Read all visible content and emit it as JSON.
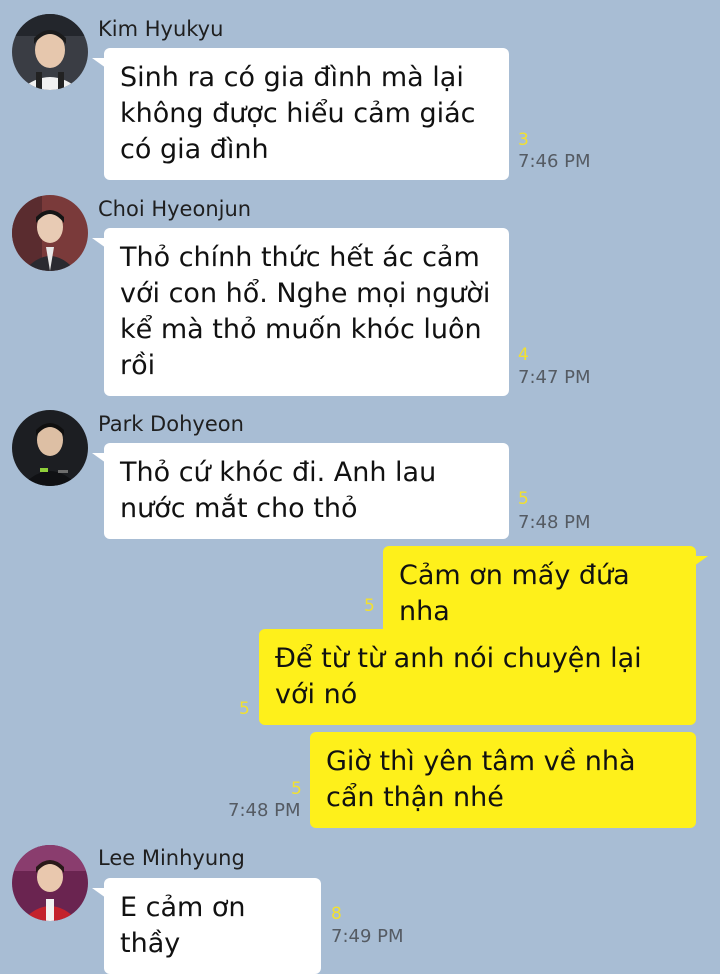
{
  "colors": {
    "background": "#a8bdd4",
    "incoming_bubble": "#ffffff",
    "outgoing_bubble": "#fef01b",
    "unread": "#f2e030"
  },
  "messages": [
    {
      "sender": "Kim Hyukyu",
      "avatar_icon": "profile-photo-icon",
      "text": "Sinh ra có gia đình mà lại không được hiểu cảm giác có gia đình",
      "unread": "3",
      "time": "7:46 PM"
    },
    {
      "sender": "Choi Hyeonjun",
      "avatar_icon": "profile-photo-icon",
      "text": "Thỏ chính thức hết ác cảm với con hổ. Nghe mọi người kể mà thỏ muốn khóc luôn rồi",
      "unread": "4",
      "time": "7:47 PM"
    },
    {
      "sender": "Park Dohyeon",
      "avatar_icon": "profile-photo-icon",
      "text": "Thỏ cứ khóc đi. Anh lau nước mắt cho thỏ",
      "unread": "5",
      "time": "7:48 PM"
    },
    {
      "sender": "",
      "text": "Cảm ơn mấy đứa nha",
      "unread": "5",
      "time": ""
    },
    {
      "sender": "",
      "text": "Để từ từ anh nói chuyện lại với nó",
      "unread": "5",
      "time": ""
    },
    {
      "sender": "",
      "text": "Giờ thì yên tâm về nhà cẩn thận nhé",
      "unread": "5",
      "time": "7:48 PM"
    },
    {
      "sender": "Lee Minhyung",
      "avatar_icon": "profile-photo-icon",
      "text": "E cảm ơn thầy",
      "unread": "8",
      "time": "7:49 PM"
    }
  ]
}
